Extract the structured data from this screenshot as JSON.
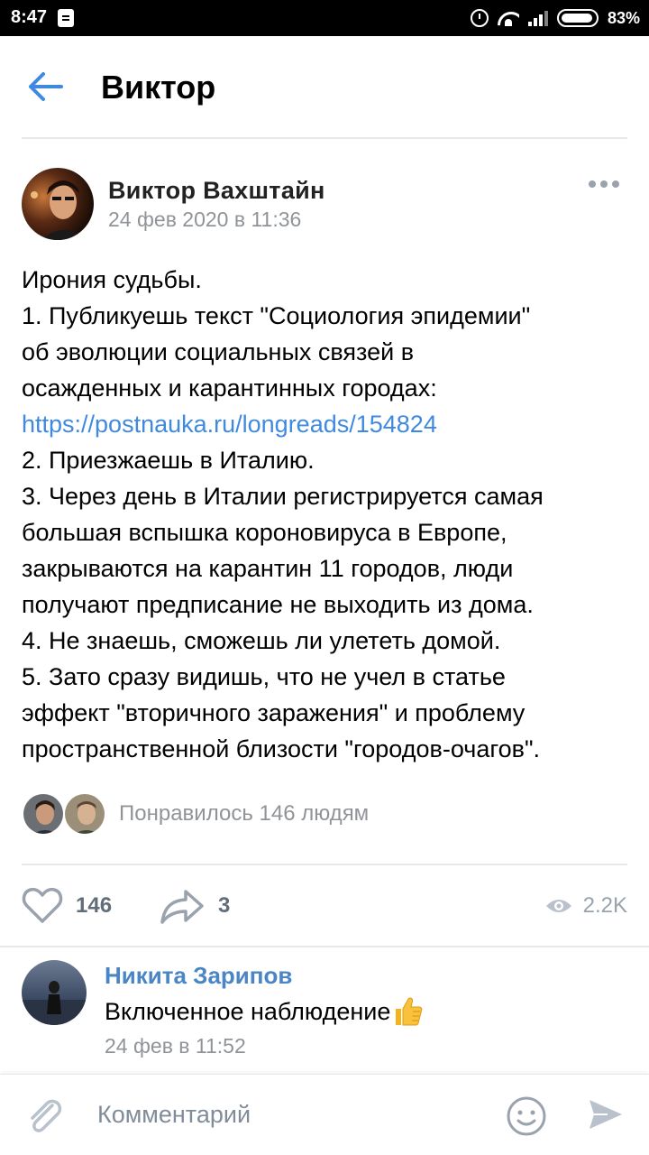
{
  "status_bar": {
    "time": "8:47",
    "battery": "83%"
  },
  "header": {
    "title": "Виктор"
  },
  "post": {
    "author": "Виктор Вахштайн",
    "date": "24 фев 2020 в 11:36",
    "lines": [
      "Ирония судьбы.",
      "1. Публикуешь текст \"Социология эпидемии\"",
      "об эволюции социальных связей в",
      "осажденных и карантинных городах:",
      "https://postnauka.ru/longreads/154824",
      "2. Приезжаешь в Италию.",
      "3. Через день в Италии регистрируется самая",
      "большая вспышка короновируса в Европе,",
      "закрываются на карантин 11 городов, люди",
      "получают предписание не выходить из дома.",
      "4. Не знаешь, сможешь ли улететь домой.",
      "5. Зато сразу видишь, что не учел в статье",
      "эффект \"вторичного заражения\" и проблему",
      "пространственной близости \"городов-очагов\"."
    ],
    "likes_text": "Понравилось 146 людям",
    "like_count": "146",
    "share_count": "3",
    "views": "2.2K"
  },
  "comment": {
    "author": "Никита Зарипов",
    "text": "Включенное наблюдение",
    "date": "24 фев в 11:52"
  },
  "composer": {
    "placeholder": "Комментарий"
  },
  "colors": {
    "link": "#3f8ae0",
    "comment_author": "#4a86c5",
    "muted": "#909499",
    "icon": "#99a2ad"
  }
}
